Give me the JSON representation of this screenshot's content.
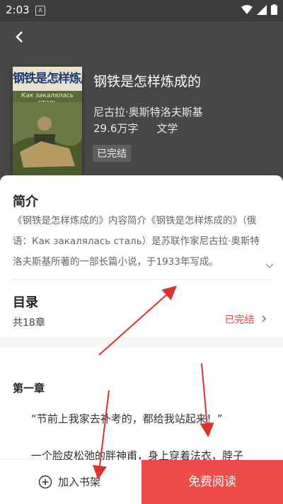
{
  "status_bar": {
    "time": "2:03",
    "notification": "A"
  },
  "book": {
    "title": "钢铁是怎样炼成的",
    "author": "尼古拉·奥斯特洛夫斯基",
    "word_count": "29.6万字",
    "genre": "文学",
    "status": "已完结",
    "cover": {
      "title": "钢铁是怎样炼成的",
      "subtitle": "Как закалялась сталь"
    }
  },
  "intro": {
    "heading": "简介",
    "text": "《钢铁是怎样炼成的》内容简介《钢铁是怎样炼成的》（俄语：Как закалялась сталь）是苏联作家尼古拉·奥斯特洛夫斯基所著的一部长篇小说，于1933年写成。"
  },
  "toc": {
    "heading": "目录",
    "chapter_count": "共18章",
    "status": "已完结"
  },
  "preview": {
    "chapter_title": "第一章",
    "para1": "“节前上我家去补考的，都给我站起来！”",
    "para2": "一个脸皮松弛的胖神甫，身上穿着法衣，脖子"
  },
  "bottom_bar": {
    "add_shelf_label": "加入书架",
    "read_label": "免费阅读"
  },
  "colors": {
    "header_bg": "#474747",
    "accent": "#ee4b4b"
  },
  "icons": [
    "back-arrow-icon",
    "chevron-down-icon",
    "chevron-right-icon",
    "add-circle-icon",
    "wifi-icon",
    "signal-icon",
    "battery-icon"
  ]
}
